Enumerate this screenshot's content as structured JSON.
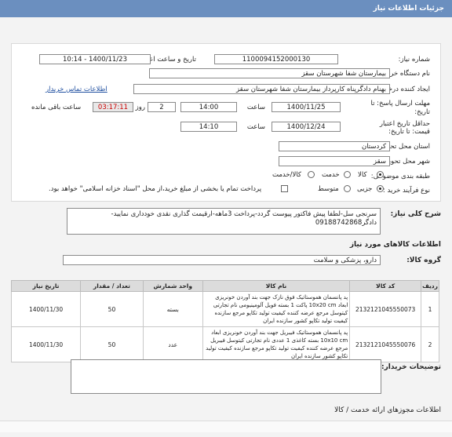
{
  "window_title": "جزئیات اطلاعات نیاز",
  "need_number": {
    "label": "شماره نیاز:",
    "value": "1100094152000130"
  },
  "announce_date": {
    "label": "تاریخ و ساعت اعلان عمومی:",
    "value": "1400/11/23 - 10:14"
  },
  "buyer_org": {
    "label": "نام دستگاه خریدار:",
    "value": "بیمارستان شفا شهرستان سقز"
  },
  "requester": {
    "label": "ایجاد کننده درخواست:",
    "value": "بهنام دادگرپناه کارپرداز بیمارستان شفا شهرستان سقز",
    "contact_link": "اطلاعات تماس خریدار"
  },
  "deadline_send": {
    "label": "مهلت ارسال پاسخ: تا",
    "sublabel": "تاریخ:",
    "date": "1400/11/25",
    "time_label": "ساعت",
    "time": "14:00",
    "days": "2",
    "days_label": "روز و",
    "remaining": "03:17:11",
    "remaining_label": "ساعت باقی مانده"
  },
  "validity": {
    "label": "حداقل تاریخ اعتبار",
    "sublabel": "قیمت: تا تاریخ:",
    "date": "1400/12/24",
    "time_label": "ساعت",
    "time": "14:10"
  },
  "province": {
    "label": "استان محل تحویل:",
    "value": "کردستان"
  },
  "city": {
    "label": "شهر محل تحویل:",
    "value": "سقز"
  },
  "category": {
    "label": "طبقه بندی موضوعی:",
    "options": [
      "کالا",
      "خدمت",
      "کالا/خدمت"
    ],
    "selected": 0
  },
  "process": {
    "label": "نوع فرآیند خرید :",
    "options": [
      "جزیی",
      "متوسط"
    ],
    "selected": 0,
    "note": "پرداخت تمام یا بخشی از مبلغ خرید،از محل \"اسناد خزانه اسلامی\" خواهد بود."
  },
  "general_desc": {
    "label": "شرح کلی نیاز:",
    "value": "سرنجی سل-لطفا پیش فاکتور پیوست گردد-پرداخت 3ماهه-ارقیمت گذاری نقدی خودداری نمایید-دادگر09188742868"
  },
  "goods_heading": "اطلاعات کالاهای مورد نیاز",
  "goods_group": {
    "label": "گروه کالا:",
    "value": "دارو، پزشکی و سلامت"
  },
  "table": {
    "headers": [
      "ردیف",
      "کد کالا",
      "نام کالا",
      "واحد شمارش",
      "تعداد / مقدار",
      "تاریخ نیاز"
    ],
    "rows": [
      {
        "idx": "1",
        "code": "2132121045550073",
        "name": "پد پانسمان هموستاتیک فوق نازک جهت بند آوردن خونریزی ابعاد 10x20 cm پاکت 1 بسته فویل آلومینیومی نام تجارتی کیتوسل مرجع عرضه کننده کیفیت تولید تکاپو مرجع سازنده کیفیت تولید تکاپو کشور سازنده ایران",
        "unit": "بسته",
        "qty": "50",
        "date": "1400/11/30"
      },
      {
        "idx": "2",
        "code": "2132121045550076",
        "name": "پد پانسمان هموستاتیک فیبریل جهت بند آوردن خونریزی ابعاد 10x10 cm بسته کاغذی 1 عددی نام تجارتی کیتوسل فیبریل مرجع عرضه کننده کیفیت تولید تکاپو مرجع سازنده کیفیت تولید تکاپو کشور سازنده ایران",
        "unit": "عدد",
        "qty": "50",
        "date": "1400/11/30"
      }
    ]
  },
  "buyer_notes": {
    "label": "توضیحات خریدار:",
    "value": ""
  },
  "permits_heading": "اطلاعات مجوزهای ارائه خدمت / کالا"
}
